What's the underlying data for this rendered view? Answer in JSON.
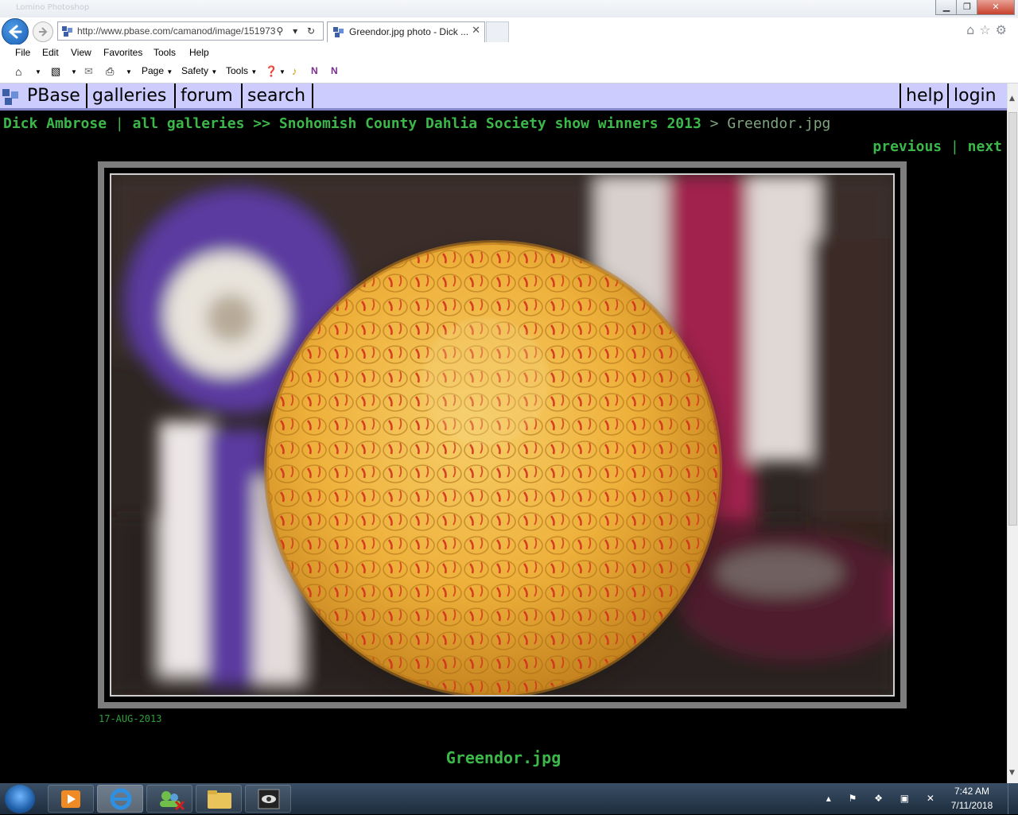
{
  "browser": {
    "titlebar_ghost": "Lomino Photoshop",
    "url": "http://www.pbase.com/camanod/image/151973",
    "tab_title": "Greendor.jpg photo - Dick ...",
    "tab_close": "✕",
    "url_icons": "⚲ ▾ ↻"
  },
  "menu": {
    "file": "File",
    "edit": "Edit",
    "view": "View",
    "favorites": "Favorites",
    "tools": "Tools",
    "help": "Help"
  },
  "command_bar": {
    "page": "Page",
    "safety": "Safety",
    "tools": "Tools"
  },
  "pbase_nav": {
    "logo": "PBase",
    "galleries": "galleries",
    "forum": "forum",
    "search": "search",
    "help": "help",
    "login": "login"
  },
  "breadcrumb": {
    "user": "Dick Ambrose",
    "sep1": " | ",
    "all_galleries": "all galleries",
    "sep2": " >> ",
    "gallery": "Snohomish County Dahlia Society show winners 2013",
    "sep3": " > ",
    "current": "Greendor.jpg"
  },
  "pager": {
    "previous": "previous",
    "sep": " | ",
    "next": "next"
  },
  "photo": {
    "date": "17-AUG-2013",
    "caption": "Greendor.jpg",
    "flower_color": "#f0b43a",
    "stripe_color": "#d4301e",
    "ribbon_color": "#5b3aa0"
  },
  "taskbar": {
    "time": "7:42 AM",
    "date": "7/11/2018",
    "tray_icons": "▴ ⚑ ❖ ▣ ✕"
  },
  "colors": {
    "link_green": "#3cb84a",
    "nav_bg": "#ccccff",
    "page_bg": "#000000"
  }
}
